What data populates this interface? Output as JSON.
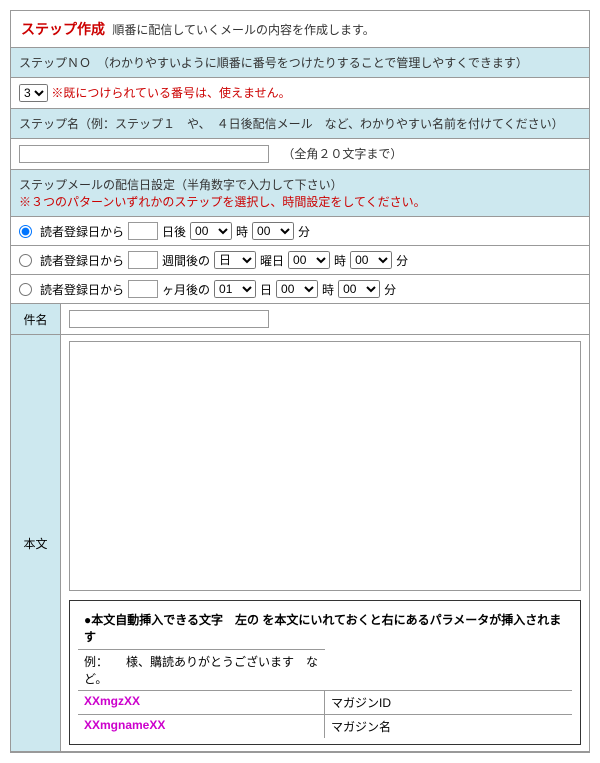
{
  "header": {
    "title": "ステップ作成",
    "desc": "順番に配信していくメールの内容を作成します。"
  },
  "stepNo": {
    "label": "ステップＮＯ　（わかりやすいように順番に番号をつけたりすることで管理しやすくできます）",
    "selected": "3",
    "note": "※既につけられている番号は、使えません。"
  },
  "stepName": {
    "label": "ステップ名（例：ステップ１　や、　４日後配信メール　など、わかりやすい名前を付けてください）",
    "note": "（全角２０文字まで）"
  },
  "schedule": {
    "header1": "ステップメールの配信日設定（半角数字で入力して下さい）",
    "header2": "※３つのパターンいずれかのステップを選択し、時間設定をしてください。",
    "opt1": {
      "label": "読者登録日から",
      "t1": "日後",
      "t2": "時",
      "t3": "分",
      "h": "00",
      "m": "00"
    },
    "opt2": {
      "label": "読者登録日から",
      "t1": "週間後の",
      "w": "日",
      "t2": "曜日",
      "t3": "時",
      "t4": "分",
      "h": "00",
      "m": "00"
    },
    "opt3": {
      "label": "読者登録日から",
      "t1": "ヶ月後の",
      "d": "01",
      "t2": "日",
      "t3": "時",
      "t4": "分",
      "h": "00",
      "m": "00"
    }
  },
  "subject": {
    "label": "件名"
  },
  "body": {
    "label": "本文",
    "paramHead": "●本文自動挿入できる文字　左の  を本文にいれておくと右にあるパラメータが挿入されます",
    "paramExample": "例：　　様、購読ありがとうございます　など。",
    "rows": [
      {
        "l": "XXmgzXX",
        "r": "マガジンID"
      },
      {
        "l": "XXmgnameXX",
        "r": "マガジン名"
      }
    ]
  }
}
